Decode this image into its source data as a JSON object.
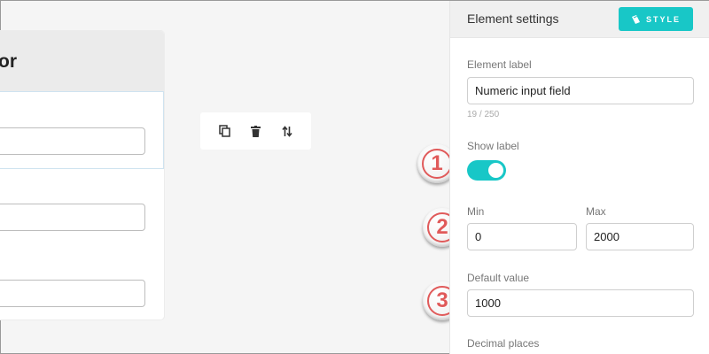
{
  "form_preview": {
    "title_fragment": "or"
  },
  "toolbar": {
    "icons": [
      "copy-icon",
      "trash-icon",
      "move-icon"
    ]
  },
  "settings_panel": {
    "title": "Element settings",
    "style_button_label": "STYLE",
    "element_label": {
      "label": "Element label",
      "value": "Numeric input field",
      "char_count": "19 / 250"
    },
    "show_label": {
      "label": "Show label",
      "enabled": true
    },
    "min": {
      "label": "Min",
      "value": "0"
    },
    "max": {
      "label": "Max",
      "value": "2000"
    },
    "default_value": {
      "label": "Default value",
      "value": "1000"
    },
    "decimal_places": {
      "label": "Decimal places"
    }
  },
  "step_badges": [
    "1",
    "2",
    "3"
  ],
  "colors": {
    "accent": "#18c7c7",
    "badge_red": "#e05a5a",
    "background": "#f5f5f5"
  }
}
